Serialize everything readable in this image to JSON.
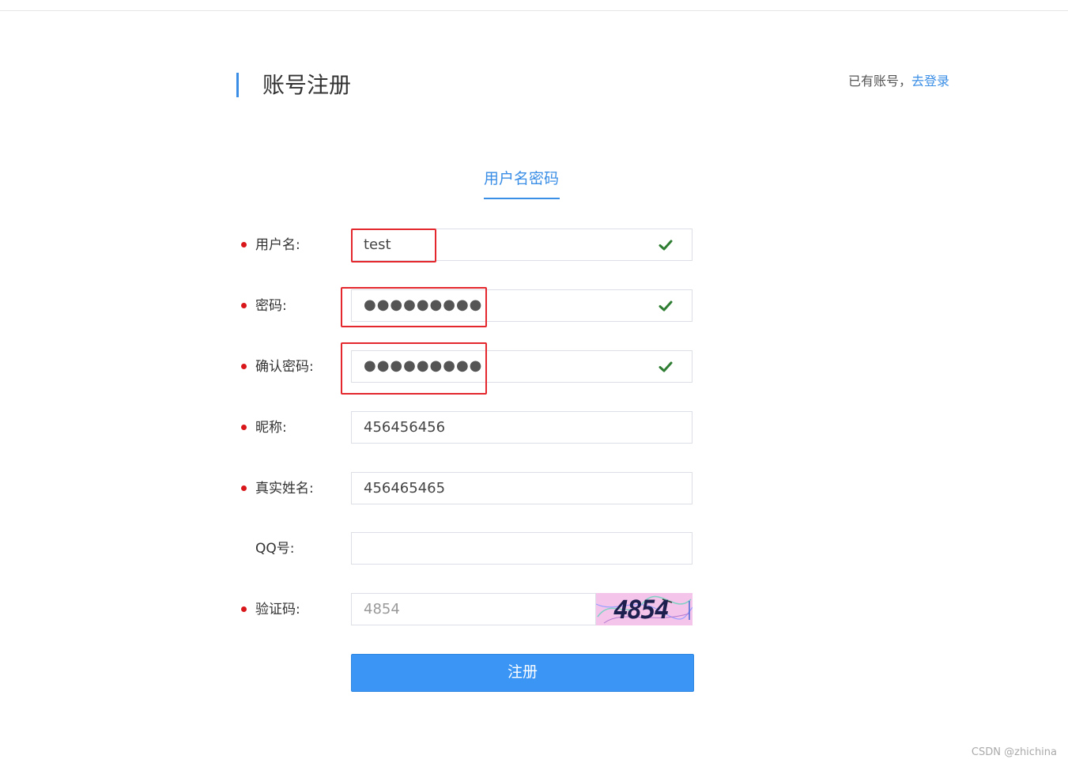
{
  "header": {
    "title": "账号注册",
    "login_prompt": "已有账号，",
    "login_link": "去登录"
  },
  "tabs": [
    {
      "label": "用户名密码",
      "active": true
    }
  ],
  "form": {
    "username": {
      "label": "用户名:",
      "value": "test",
      "required": true,
      "valid": true
    },
    "password": {
      "label": "密码:",
      "value": "●●●●●●●●●",
      "required": true,
      "valid": true
    },
    "confirm_password": {
      "label": "确认密码:",
      "value": "●●●●●●●●●",
      "required": true,
      "valid": true
    },
    "nickname": {
      "label": "昵称:",
      "value": "456456456",
      "required": true
    },
    "real_name": {
      "label": "真实姓名:",
      "value": "456465465",
      "required": true
    },
    "qq": {
      "label": "QQ号:",
      "value": "",
      "required": false
    },
    "captcha": {
      "label": "验证码:",
      "placeholder": "4854",
      "required": true,
      "image_text": "4854"
    },
    "submit_label": "注册"
  },
  "watermark": "CSDN @zhichina",
  "colors": {
    "accent": "#3a8ee6",
    "button": "#3a95f5",
    "required_dot": "#d9171b",
    "valid_check": "#2e7d32",
    "highlight": "#e3272d",
    "captcha_bg": "#f4c4ea"
  },
  "icons": {
    "valid": "check-icon",
    "required": "required-dot"
  }
}
